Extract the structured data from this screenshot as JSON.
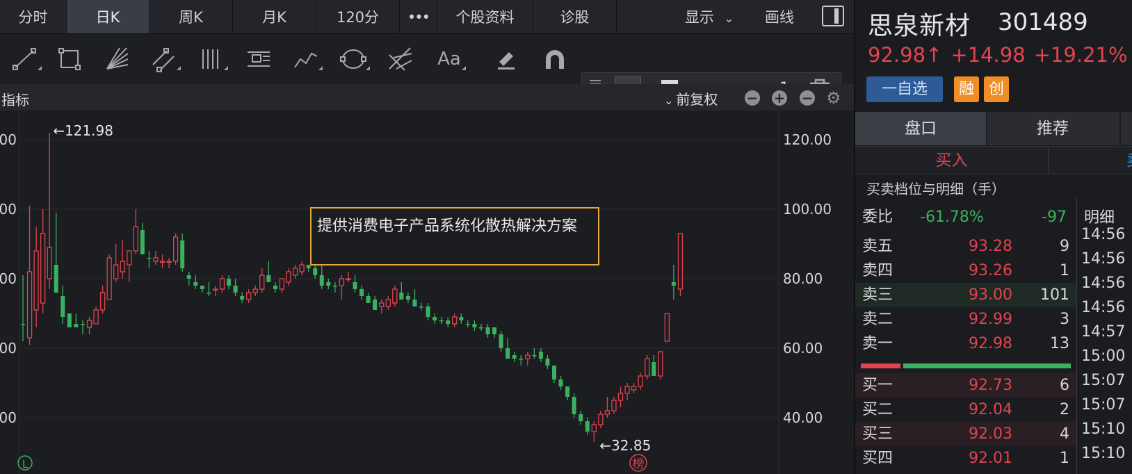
{
  "period_tabs": [
    {
      "label": "分时",
      "active": false
    },
    {
      "label": "日K",
      "active": true
    },
    {
      "label": "周K",
      "active": false
    },
    {
      "label": "月K",
      "active": false
    },
    {
      "label": "120分",
      "active": false
    },
    {
      "label": "•••",
      "active": false
    },
    {
      "label": "个股资料",
      "active": false
    },
    {
      "label": "诊股",
      "active": false
    }
  ],
  "top_right": {
    "display_label": "显示",
    "draw_label": "画线"
  },
  "toolbar": {
    "tools": [
      "line-segment-icon",
      "rectangle-icon",
      "fan-icon",
      "parallel-channel-icon",
      "vertical-lines-icon",
      "gann-box-icon",
      "polyline-icon",
      "ellipse-icon",
      "pitchfork-icon",
      "text-tool-icon",
      "eraser-icon",
      "magnet-icon"
    ],
    "text_tool_label": "Aa",
    "line_color": "#f5a623",
    "line_width_value": "1"
  },
  "indicator_bar": {
    "label": "指标",
    "adjust_label": "前复权"
  },
  "chart_data": {
    "type": "candlestick",
    "y_axis": {
      "ticks": [
        "120.00",
        "100.00",
        "80.00",
        "60.00",
        "40.00"
      ],
      "values": [
        120,
        100,
        80,
        60,
        40
      ],
      "left_partial_labels": [
        ".00",
        "00",
        "00",
        ".00",
        "00"
      ]
    },
    "max_label": "←121.98",
    "min_label": "←32.85",
    "annotation": "提供消费电子产品系统化散热解决方案",
    "bottom_left_badge": "L",
    "bottom_right_badge": "榜",
    "up_color": "#e0454f",
    "down_color": "#3ab160",
    "candles": [
      {
        "o": 67,
        "h": 81,
        "l": 62,
        "c": 67,
        "up": false
      },
      {
        "o": 63,
        "h": 101,
        "l": 61,
        "c": 82,
        "up": true
      },
      {
        "o": 71,
        "h": 95,
        "l": 66,
        "c": 88,
        "up": true
      },
      {
        "o": 73,
        "h": 100,
        "l": 70,
        "c": 93,
        "up": true
      },
      {
        "o": 80,
        "h": 122,
        "l": 77,
        "c": 89,
        "up": true
      },
      {
        "o": 84,
        "h": 99,
        "l": 79,
        "c": 76,
        "up": false
      },
      {
        "o": 75,
        "h": 78,
        "l": 67,
        "c": 69,
        "up": false
      },
      {
        "o": 70,
        "h": 70,
        "l": 66,
        "c": 66,
        "up": false
      },
      {
        "o": 67,
        "h": 70,
        "l": 66,
        "c": 66,
        "up": false
      },
      {
        "o": 67,
        "h": 68,
        "l": 64,
        "c": 67,
        "up": false
      },
      {
        "o": 66,
        "h": 69,
        "l": 64,
        "c": 68,
        "up": true
      },
      {
        "o": 67,
        "h": 72,
        "l": 67,
        "c": 71,
        "up": true
      },
      {
        "o": 71,
        "h": 78,
        "l": 70,
        "c": 76,
        "up": true
      },
      {
        "o": 74,
        "h": 87,
        "l": 74,
        "c": 86,
        "up": true
      },
      {
        "o": 80,
        "h": 90,
        "l": 79,
        "c": 84,
        "up": true
      },
      {
        "o": 82,
        "h": 91,
        "l": 80,
        "c": 85,
        "up": true
      },
      {
        "o": 84,
        "h": 88,
        "l": 79,
        "c": 88,
        "up": true
      },
      {
        "o": 88,
        "h": 100,
        "l": 87,
        "c": 95,
        "up": true
      },
      {
        "o": 94,
        "h": 96,
        "l": 87,
        "c": 87,
        "up": false
      },
      {
        "o": 86,
        "h": 88,
        "l": 83,
        "c": 86,
        "up": false
      },
      {
        "o": 85,
        "h": 88,
        "l": 84,
        "c": 86,
        "up": true
      },
      {
        "o": 85,
        "h": 87,
        "l": 83,
        "c": 85,
        "up": true
      },
      {
        "o": 85,
        "h": 86,
        "l": 83,
        "c": 85,
        "up": true
      },
      {
        "o": 85,
        "h": 93,
        "l": 84,
        "c": 92,
        "up": true
      },
      {
        "o": 91,
        "h": 93,
        "l": 82,
        "c": 83,
        "up": false
      },
      {
        "o": 81,
        "h": 82,
        "l": 78,
        "c": 80,
        "up": false
      },
      {
        "o": 79,
        "h": 81,
        "l": 77,
        "c": 78,
        "up": false
      },
      {
        "o": 78,
        "h": 78,
        "l": 76,
        "c": 77,
        "up": false
      },
      {
        "o": 76,
        "h": 79,
        "l": 75,
        "c": 76,
        "up": false
      },
      {
        "o": 77,
        "h": 78,
        "l": 75,
        "c": 77,
        "up": true
      },
      {
        "o": 77,
        "h": 81,
        "l": 76,
        "c": 80,
        "up": true
      },
      {
        "o": 80,
        "h": 81,
        "l": 77,
        "c": 78,
        "up": false
      },
      {
        "o": 78,
        "h": 80,
        "l": 75,
        "c": 76,
        "up": false
      },
      {
        "o": 75,
        "h": 76,
        "l": 73,
        "c": 74,
        "up": false
      },
      {
        "o": 74,
        "h": 77,
        "l": 73,
        "c": 76,
        "up": true
      },
      {
        "o": 76,
        "h": 78,
        "l": 75,
        "c": 77,
        "up": true
      },
      {
        "o": 77,
        "h": 83,
        "l": 76,
        "c": 81,
        "up": true
      },
      {
        "o": 81,
        "h": 85,
        "l": 79,
        "c": 79,
        "up": false
      },
      {
        "o": 78,
        "h": 79,
        "l": 76,
        "c": 77,
        "up": false
      },
      {
        "o": 77,
        "h": 80,
        "l": 76,
        "c": 80,
        "up": true
      },
      {
        "o": 79,
        "h": 83,
        "l": 78,
        "c": 82,
        "up": true
      },
      {
        "o": 81,
        "h": 84,
        "l": 80,
        "c": 83,
        "up": true
      },
      {
        "o": 82,
        "h": 85,
        "l": 81,
        "c": 84,
        "up": true
      },
      {
        "o": 84,
        "h": 84,
        "l": 82,
        "c": 83,
        "up": false
      },
      {
        "o": 83,
        "h": 85,
        "l": 80,
        "c": 81,
        "up": false
      },
      {
        "o": 81,
        "h": 84,
        "l": 77,
        "c": 78,
        "up": false
      },
      {
        "o": 78,
        "h": 80,
        "l": 77,
        "c": 79,
        "up": false
      },
      {
        "o": 78,
        "h": 79,
        "l": 76,
        "c": 78,
        "up": false
      },
      {
        "o": 78,
        "h": 81,
        "l": 74,
        "c": 80,
        "up": true
      },
      {
        "o": 80,
        "h": 82,
        "l": 79,
        "c": 80,
        "up": true
      },
      {
        "o": 79,
        "h": 81,
        "l": 76,
        "c": 77,
        "up": false
      },
      {
        "o": 77,
        "h": 78,
        "l": 74,
        "c": 75,
        "up": false
      },
      {
        "o": 75,
        "h": 76,
        "l": 73,
        "c": 73,
        "up": false
      },
      {
        "o": 74,
        "h": 75,
        "l": 71,
        "c": 71,
        "up": false
      },
      {
        "o": 72,
        "h": 74,
        "l": 70,
        "c": 73,
        "up": true
      },
      {
        "o": 72,
        "h": 75,
        "l": 71,
        "c": 74,
        "up": true
      },
      {
        "o": 73,
        "h": 78,
        "l": 72,
        "c": 77,
        "up": true
      },
      {
        "o": 76,
        "h": 79,
        "l": 74,
        "c": 74,
        "up": false
      },
      {
        "o": 75,
        "h": 76,
        "l": 73,
        "c": 74,
        "up": false
      },
      {
        "o": 74,
        "h": 77,
        "l": 72,
        "c": 72,
        "up": false
      },
      {
        "o": 72,
        "h": 73,
        "l": 71,
        "c": 72,
        "up": false
      },
      {
        "o": 72,
        "h": 73,
        "l": 68,
        "c": 69,
        "up": false
      },
      {
        "o": 69,
        "h": 70,
        "l": 67,
        "c": 68,
        "up": false
      },
      {
        "o": 68,
        "h": 69,
        "l": 67,
        "c": 68,
        "up": false
      },
      {
        "o": 68,
        "h": 69,
        "l": 66,
        "c": 67,
        "up": false
      },
      {
        "o": 67,
        "h": 70,
        "l": 66,
        "c": 69,
        "up": true
      },
      {
        "o": 69,
        "h": 70,
        "l": 67,
        "c": 68,
        "up": false
      },
      {
        "o": 67,
        "h": 68,
        "l": 66,
        "c": 67,
        "up": false
      },
      {
        "o": 66,
        "h": 68,
        "l": 65,
        "c": 67,
        "up": false
      },
      {
        "o": 66,
        "h": 67,
        "l": 65,
        "c": 66,
        "up": false
      },
      {
        "o": 66,
        "h": 67,
        "l": 63,
        "c": 64,
        "up": false
      },
      {
        "o": 64,
        "h": 66,
        "l": 63,
        "c": 66,
        "up": false
      },
      {
        "o": 64,
        "h": 65,
        "l": 59,
        "c": 60,
        "up": false
      },
      {
        "o": 60,
        "h": 63,
        "l": 59,
        "c": 57,
        "up": false
      },
      {
        "o": 58,
        "h": 59,
        "l": 56,
        "c": 57,
        "up": false
      },
      {
        "o": 57,
        "h": 58,
        "l": 55,
        "c": 57,
        "up": false
      },
      {
        "o": 57,
        "h": 59,
        "l": 55,
        "c": 58,
        "up": true
      },
      {
        "o": 58,
        "h": 60,
        "l": 57,
        "c": 58,
        "up": false
      },
      {
        "o": 59,
        "h": 60,
        "l": 56,
        "c": 57,
        "up": false
      },
      {
        "o": 57,
        "h": 58,
        "l": 54,
        "c": 55,
        "up": false
      },
      {
        "o": 55,
        "h": 55,
        "l": 50,
        "c": 51,
        "up": false
      },
      {
        "o": 51,
        "h": 52,
        "l": 48,
        "c": 49,
        "up": false
      },
      {
        "o": 49,
        "h": 49,
        "l": 45,
        "c": 46,
        "up": false
      },
      {
        "o": 46,
        "h": 47,
        "l": 40,
        "c": 41,
        "up": false
      },
      {
        "o": 41,
        "h": 42,
        "l": 38,
        "c": 39,
        "up": false
      },
      {
        "o": 39,
        "h": 40,
        "l": 35,
        "c": 36,
        "up": false
      },
      {
        "o": 36,
        "h": 39,
        "l": 33,
        "c": 38,
        "up": true
      },
      {
        "o": 38,
        "h": 42,
        "l": 37,
        "c": 41,
        "up": true
      },
      {
        "o": 41,
        "h": 46,
        "l": 40,
        "c": 42,
        "up": true
      },
      {
        "o": 42,
        "h": 46,
        "l": 41,
        "c": 45,
        "up": true
      },
      {
        "o": 45,
        "h": 49,
        "l": 43,
        "c": 47,
        "up": true
      },
      {
        "o": 47,
        "h": 50,
        "l": 45,
        "c": 49,
        "up": true
      },
      {
        "o": 48,
        "h": 50,
        "l": 47,
        "c": 49,
        "up": true
      },
      {
        "o": 49,
        "h": 53,
        "l": 48,
        "c": 52,
        "up": true
      },
      {
        "o": 52,
        "h": 58,
        "l": 51,
        "c": 57,
        "up": true
      },
      {
        "o": 56,
        "h": 58,
        "l": 52,
        "c": 52,
        "up": false
      },
      {
        "o": 52,
        "h": 59,
        "l": 51,
        "c": 59,
        "up": true
      },
      {
        "o": 62,
        "h": 70,
        "l": 62,
        "c": 70,
        "up": true
      },
      {
        "o": 79,
        "h": 84,
        "l": 74,
        "c": 78,
        "up": false
      },
      {
        "o": 77,
        "h": 93,
        "l": 75,
        "c": 93,
        "up": true
      }
    ]
  },
  "stock": {
    "name": "思泉新材",
    "code": "301489",
    "price": "92.98↑",
    "change": "+14.98",
    "change_pct": "+19.21%",
    "watch_label": "一自选",
    "tag_margin": "融",
    "tag_gem": "创"
  },
  "right_tabs": [
    {
      "label": "盘口",
      "active": true
    },
    {
      "label": "推荐",
      "active": false
    }
  ],
  "trade_tabs": {
    "buy_label": "买入",
    "sell_edge": "卖"
  },
  "orderbook": {
    "header": "买卖档位与明细（手）",
    "committee_label": "委比",
    "committee_pct": "-61.78%",
    "committee_diff": "-97",
    "sells": [
      {
        "label": "卖五",
        "price": "93.28",
        "vol": "9"
      },
      {
        "label": "卖四",
        "price": "93.26",
        "vol": "1"
      },
      {
        "label": "卖三",
        "price": "93.00",
        "vol": "101"
      },
      {
        "label": "卖二",
        "price": "92.99",
        "vol": "3"
      },
      {
        "label": "卖一",
        "price": "92.98",
        "vol": "13"
      }
    ],
    "buys": [
      {
        "label": "买一",
        "price": "92.73",
        "vol": "6"
      },
      {
        "label": "买二",
        "price": "92.04",
        "vol": "2"
      },
      {
        "label": "买三",
        "price": "92.03",
        "vol": "4"
      },
      {
        "label": "买四",
        "price": "92.01",
        "vol": "1"
      }
    ],
    "buy_ratio": 0.19
  },
  "ticks": {
    "header": "明细",
    "times": [
      "14:56",
      "14:56",
      "14:56",
      "14:56",
      "14:57",
      "15:00",
      "15:07",
      "15:07",
      "15:10",
      "15:10"
    ]
  }
}
